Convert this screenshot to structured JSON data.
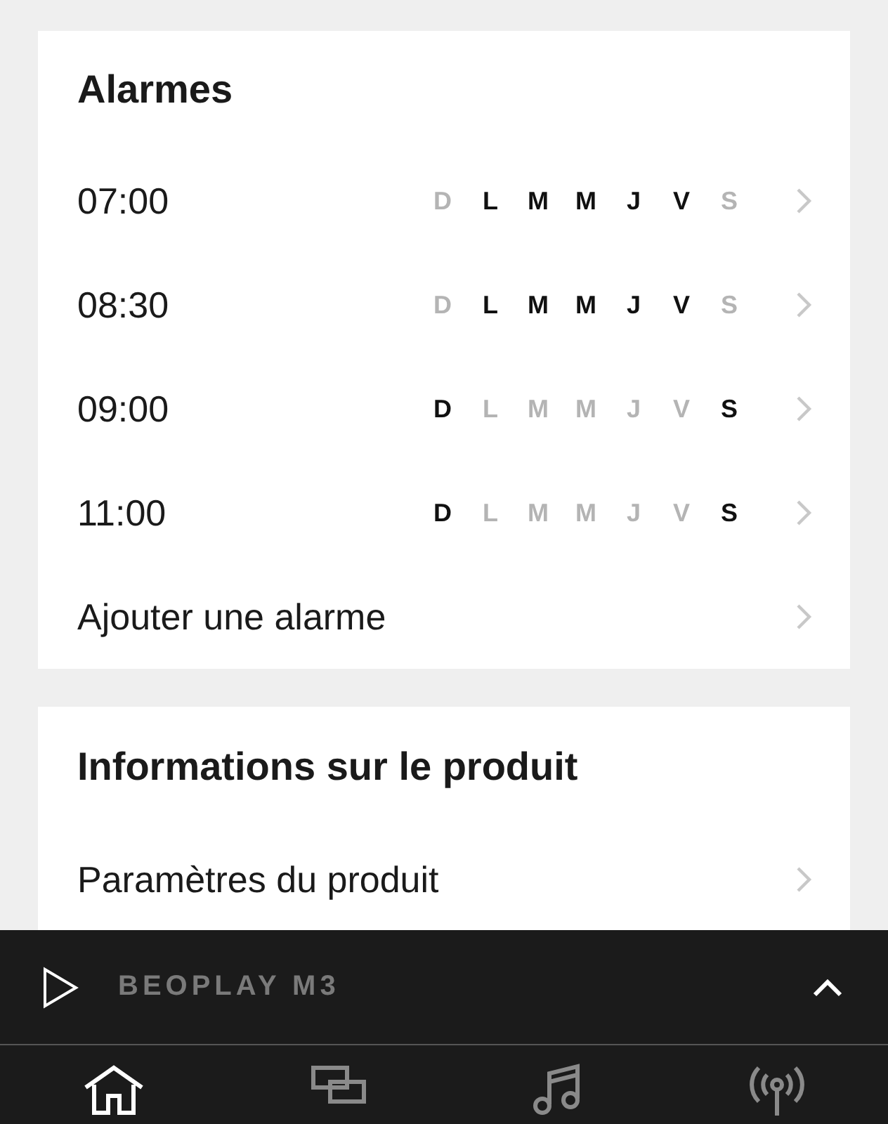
{
  "alarms": {
    "title": "Alarmes",
    "items": [
      {
        "time": "07:00",
        "days": [
          {
            "label": "D",
            "on": false
          },
          {
            "label": "L",
            "on": true
          },
          {
            "label": "M",
            "on": true
          },
          {
            "label": "M",
            "on": true
          },
          {
            "label": "J",
            "on": true
          },
          {
            "label": "V",
            "on": true
          },
          {
            "label": "S",
            "on": false
          }
        ]
      },
      {
        "time": "08:30",
        "days": [
          {
            "label": "D",
            "on": false
          },
          {
            "label": "L",
            "on": true
          },
          {
            "label": "M",
            "on": true
          },
          {
            "label": "M",
            "on": true
          },
          {
            "label": "J",
            "on": true
          },
          {
            "label": "V",
            "on": true
          },
          {
            "label": "S",
            "on": false
          }
        ]
      },
      {
        "time": "09:00",
        "days": [
          {
            "label": "D",
            "on": true
          },
          {
            "label": "L",
            "on": false
          },
          {
            "label": "M",
            "on": false
          },
          {
            "label": "M",
            "on": false
          },
          {
            "label": "J",
            "on": false
          },
          {
            "label": "V",
            "on": false
          },
          {
            "label": "S",
            "on": true
          }
        ]
      },
      {
        "time": "11:00",
        "days": [
          {
            "label": "D",
            "on": true
          },
          {
            "label": "L",
            "on": false
          },
          {
            "label": "M",
            "on": false
          },
          {
            "label": "M",
            "on": false
          },
          {
            "label": "J",
            "on": false
          },
          {
            "label": "V",
            "on": false
          },
          {
            "label": "S",
            "on": true
          }
        ]
      }
    ],
    "add_label": "Ajouter une alarme"
  },
  "product_info": {
    "title": "Informations sur le produit",
    "items": [
      "Paramètres du produit"
    ]
  },
  "player": {
    "device": "BEOPLAY M3"
  },
  "tabs": [
    {
      "kind": "home",
      "selected": true
    },
    {
      "kind": "rooms",
      "selected": false
    },
    {
      "kind": "music",
      "selected": false
    },
    {
      "kind": "radio",
      "selected": false
    }
  ]
}
